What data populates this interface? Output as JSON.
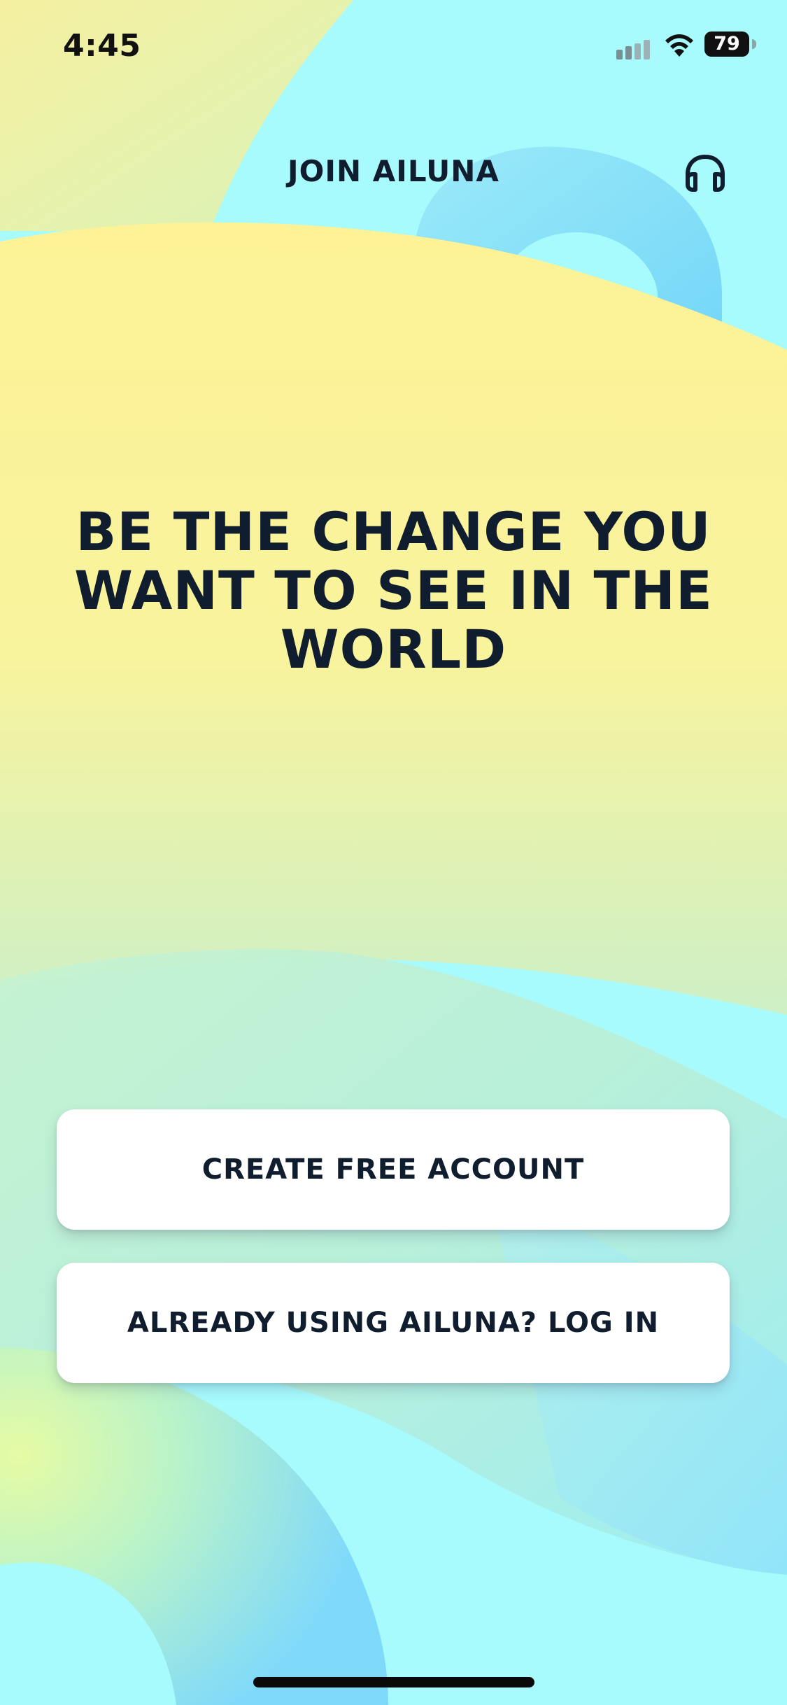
{
  "status_bar": {
    "time": "4:45",
    "battery_level": "79"
  },
  "header": {
    "title": "JOIN AILUNA",
    "headphones_icon": "headphones-icon"
  },
  "hero": {
    "text": "BE THE CHANGE YOU\nWANT TO SEE IN THE\nWORLD"
  },
  "actions": {
    "create_account_label": "CREATE FREE ACCOUNT",
    "login_label": "ALREADY USING AILUNA? LOG IN"
  },
  "colors": {
    "text_dark": "#0f1d2e",
    "bg_yellow": "#fdf394",
    "bg_cyan": "#a7fbfd",
    "bg_blue": "#7fd9fb",
    "button_white": "#ffffff"
  }
}
